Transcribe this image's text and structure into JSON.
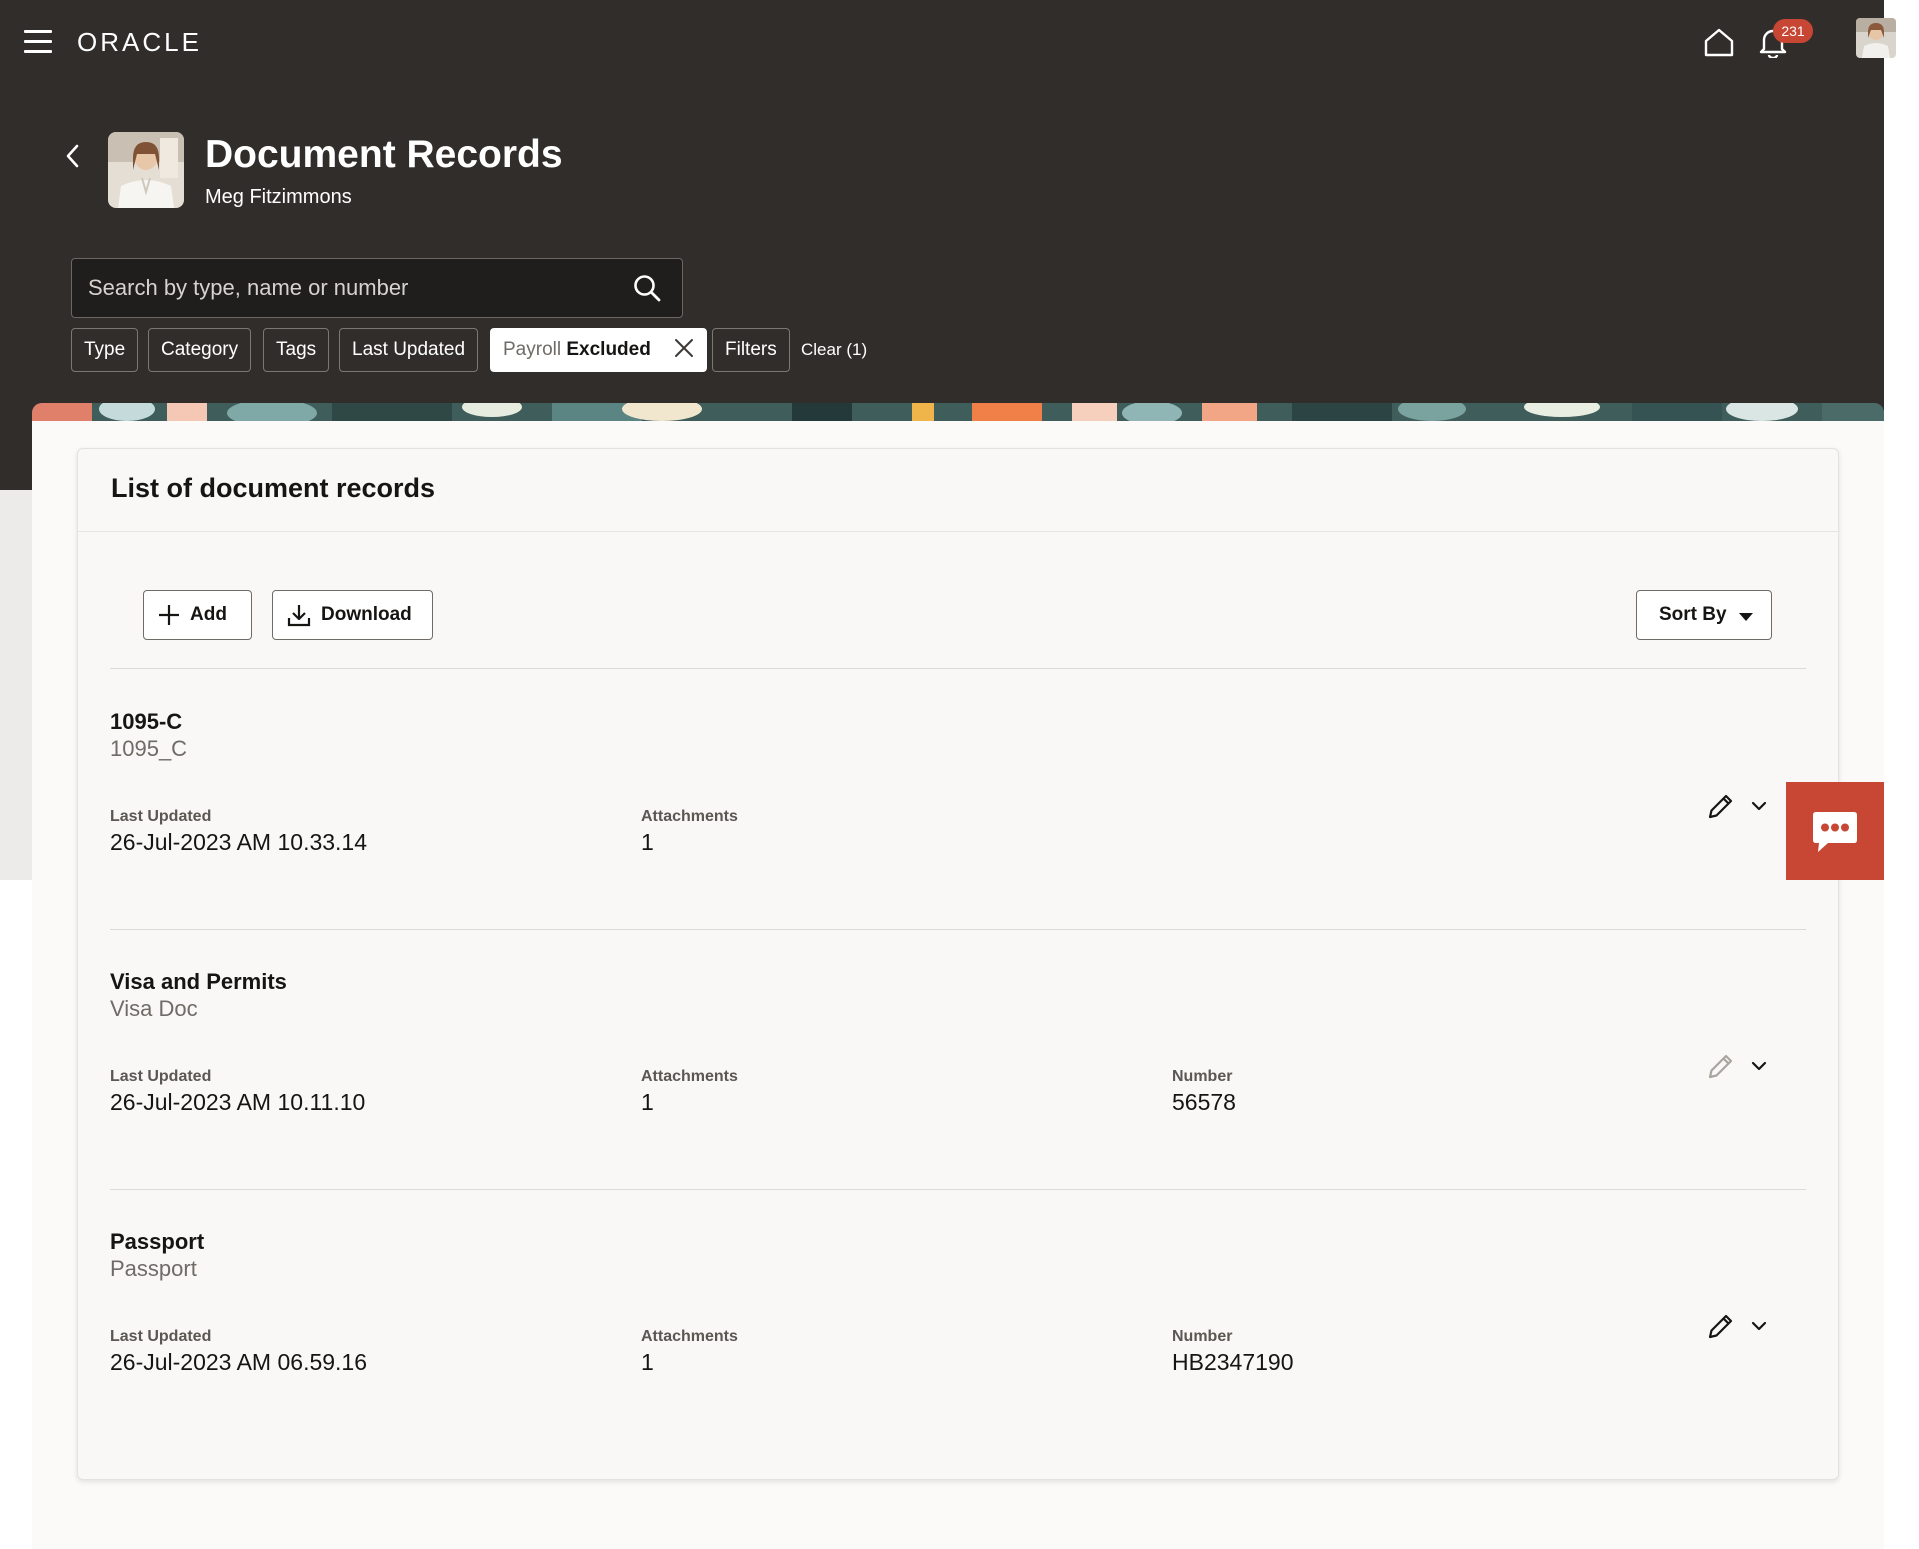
{
  "topbar": {
    "brand": "ORACLE",
    "notification_count": "231"
  },
  "header": {
    "title": "Document Records",
    "person_name": "Meg Fitzimmons"
  },
  "search": {
    "placeholder": "Search by type, name or number"
  },
  "filters": {
    "type": "Type",
    "category": "Category",
    "tags": "Tags",
    "last_updated": "Last Updated",
    "selected_key": "Payroll",
    "selected_value": "Excluded",
    "filters": "Filters",
    "clear": "Clear (1)"
  },
  "card": {
    "title": "List of document records",
    "add_label": "Add",
    "download_label": "Download",
    "sort_label": "Sort By"
  },
  "records": [
    {
      "name": "1095-C",
      "type": "1095_C",
      "last_updated_label": "Last Updated",
      "last_updated": "26-Jul-2023 AM 10.33.14",
      "attachments_label": "Attachments",
      "attachments": "1",
      "edit_enabled": true
    },
    {
      "name": "Visa and Permits",
      "type": "Visa Doc",
      "last_updated_label": "Last Updated",
      "last_updated": "26-Jul-2023 AM 10.11.10",
      "attachments_label": "Attachments",
      "attachments": "1",
      "number_label": "Number",
      "number": "56578",
      "edit_enabled": false
    },
    {
      "name": "Passport",
      "type": "Passport",
      "last_updated_label": "Last Updated",
      "last_updated": "26-Jul-2023 AM 06.59.16",
      "attachments_label": "Attachments",
      "attachments": "1",
      "number_label": "Number",
      "number": "HB2347190",
      "edit_enabled": true
    }
  ],
  "colors": {
    "header_bg": "#312d2a",
    "accent_red": "#c74634",
    "card_bg": "#f9f8f6"
  },
  "icons": [
    "hamburger-icon",
    "home-icon",
    "bell-icon",
    "back-chevron-icon",
    "search-icon",
    "close-icon",
    "plus-icon",
    "download-icon",
    "caret-down-icon",
    "pencil-icon",
    "chevron-down-icon",
    "chat-icon"
  ]
}
